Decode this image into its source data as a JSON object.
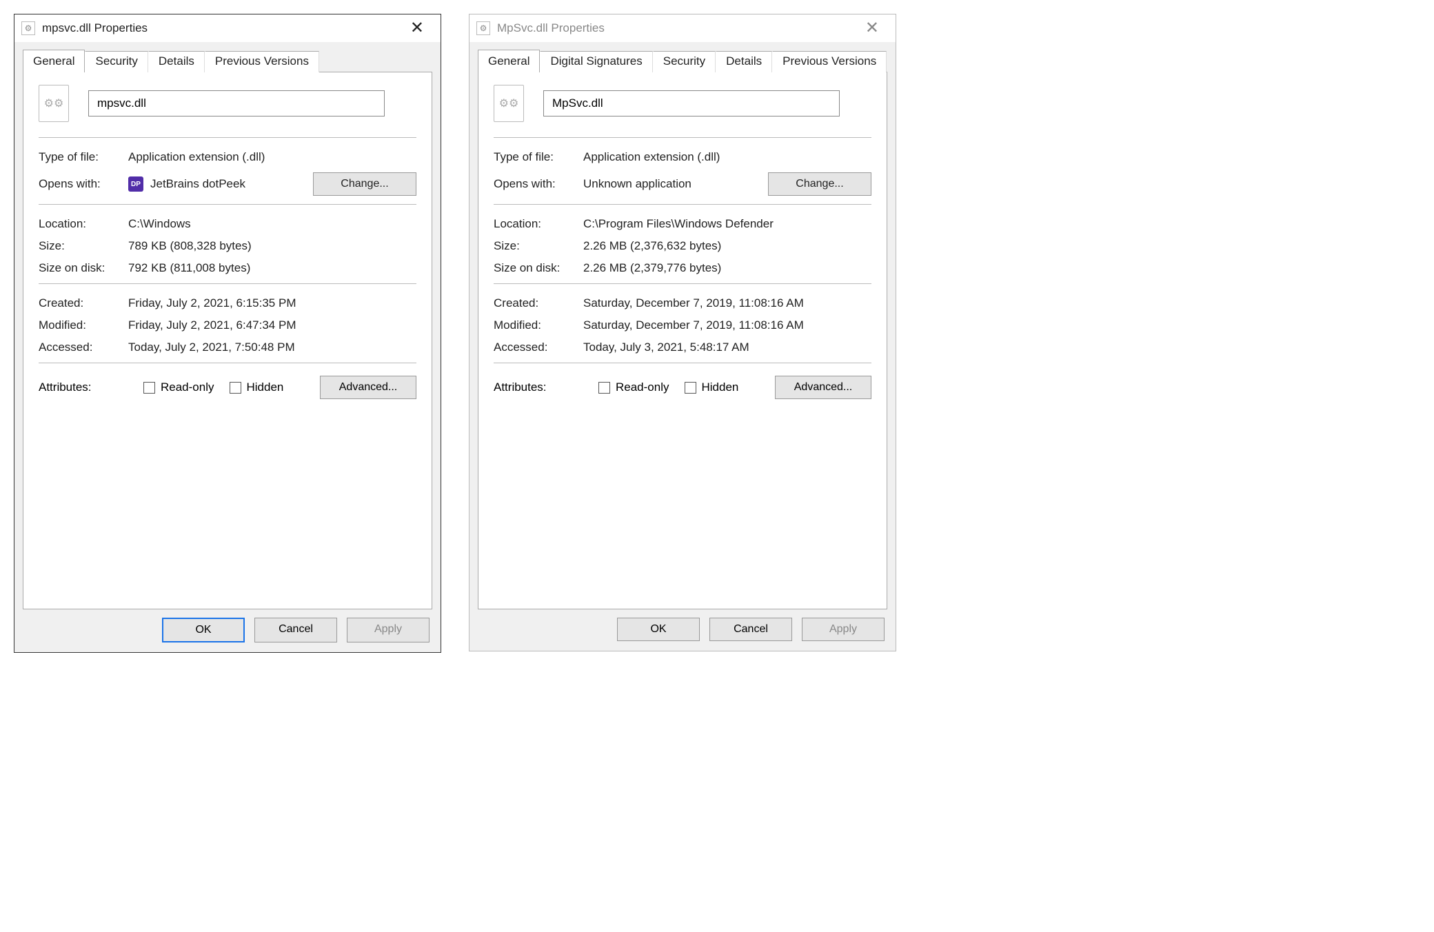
{
  "dialogs": [
    {
      "title": "mpsvc.dll Properties",
      "tabs": [
        "General",
        "Security",
        "Details",
        "Previous Versions"
      ],
      "active_tab": "General",
      "filename": "mpsvc.dll",
      "type_label": "Type of file:",
      "type_value": "Application extension (.dll)",
      "opens_label": "Opens with:",
      "opens_value": "JetBrains dotPeek",
      "opens_app_icon": "DP",
      "show_app_icon": true,
      "change_label": "Change...",
      "location_label": "Location:",
      "location_value": "C:\\Windows",
      "size_label": "Size:",
      "size_value": "789 KB (808,328 bytes)",
      "sod_label": "Size on disk:",
      "sod_value": "792 KB (811,008 bytes)",
      "created_label": "Created:",
      "created_value": "Friday, July 2, 2021, 6:15:35 PM",
      "modified_label": "Modified:",
      "modified_value": "Friday, July 2, 2021, 6:47:34 PM",
      "accessed_label": "Accessed:",
      "accessed_value": "Today, July 2, 2021, 7:50:48 PM",
      "attrs_label": "Attributes:",
      "readonly_label": "Read-only",
      "hidden_label": "Hidden",
      "advanced_label": "Advanced...",
      "ok_label": "OK",
      "cancel_label": "Cancel",
      "apply_label": "Apply"
    },
    {
      "title": "MpSvc.dll Properties",
      "tabs": [
        "General",
        "Digital Signatures",
        "Security",
        "Details",
        "Previous Versions"
      ],
      "active_tab": "General",
      "filename": "MpSvc.dll",
      "type_label": "Type of file:",
      "type_value": "Application extension (.dll)",
      "opens_label": "Opens with:",
      "opens_value": "Unknown application",
      "opens_app_icon": "",
      "show_app_icon": false,
      "change_label": "Change...",
      "location_label": "Location:",
      "location_value": "C:\\Program Files\\Windows Defender",
      "size_label": "Size:",
      "size_value": "2.26 MB (2,376,632 bytes)",
      "sod_label": "Size on disk:",
      "sod_value": "2.26 MB (2,379,776 bytes)",
      "created_label": "Created:",
      "created_value": "Saturday, December 7, 2019, 11:08:16 AM",
      "modified_label": "Modified:",
      "modified_value": "Saturday, December 7, 2019, 11:08:16 AM",
      "accessed_label": "Accessed:",
      "accessed_value": "Today, July 3, 2021, 5:48:17 AM",
      "attrs_label": "Attributes:",
      "readonly_label": "Read-only",
      "hidden_label": "Hidden",
      "advanced_label": "Advanced...",
      "ok_label": "OK",
      "cancel_label": "Cancel",
      "apply_label": "Apply"
    }
  ]
}
